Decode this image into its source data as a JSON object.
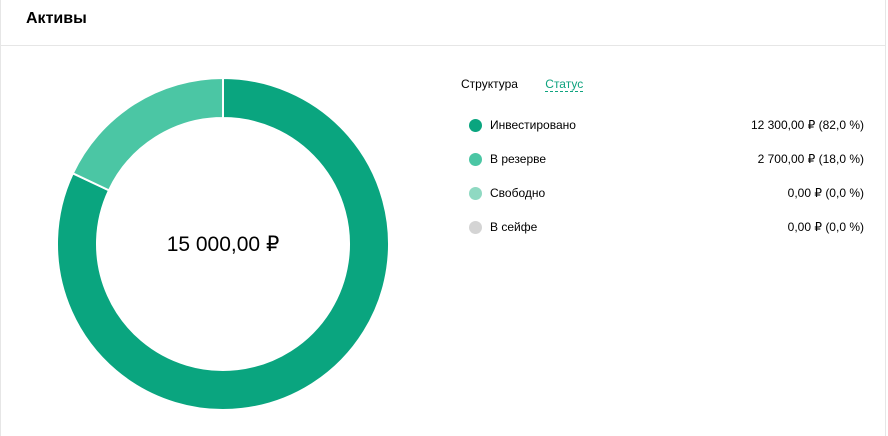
{
  "header": {
    "title": "Активы"
  },
  "tabs": [
    {
      "label": "Структура"
    },
    {
      "label": "Статус"
    }
  ],
  "total": "15 000,00 ₽",
  "colors": {
    "invested": "#0aa57f",
    "reserve": "#4bc6a4",
    "free": "#8fd9c2",
    "safe": "#d4d4d4"
  },
  "legend": [
    {
      "label": "Инвестировано",
      "value": "12 300,00 ₽ (82,0 %)"
    },
    {
      "label": "В резерве",
      "value": "2 700,00 ₽ (18,0 %)"
    },
    {
      "label": "Свободно",
      "value": "0,00 ₽ (0,0 %)"
    },
    {
      "label": "В сейфе",
      "value": "0,00 ₽ (0,0 %)"
    }
  ],
  "chart_data": {
    "type": "pie",
    "categories": [
      "Инвестировано",
      "В резерве",
      "Свободно",
      "В сейфе"
    ],
    "values": [
      82.0,
      18.0,
      0.0,
      0.0
    ]
  }
}
